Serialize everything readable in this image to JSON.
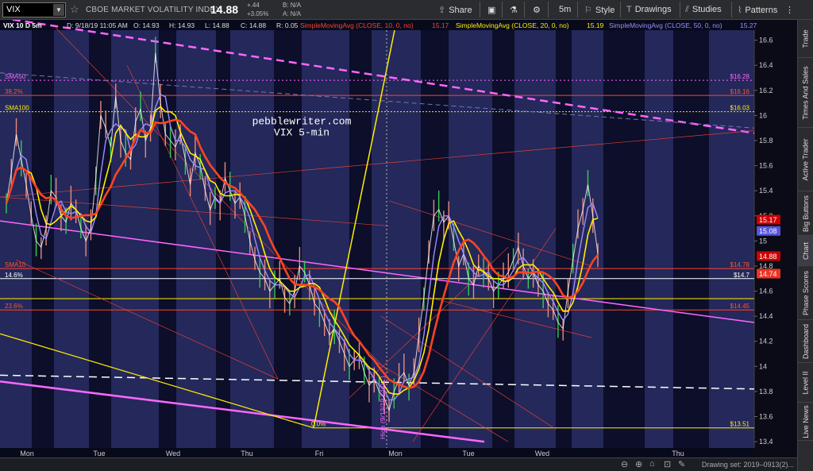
{
  "toolbar": {
    "symbol": "VIX",
    "symbol_name": "CBOE MARKET VOLATILITY INDEX",
    "last_price": "14.88",
    "change": "+.44",
    "change_pct": "+3.05%",
    "bid": "B: N/A",
    "ask": "A: N/A",
    "share": "Share",
    "timeframe": "5m",
    "style": "Style",
    "drawings": "Drawings",
    "studies": "Studies",
    "patterns": "Patterns"
  },
  "status": {
    "header": "VIX 10 D 5m",
    "datetime": "D: 9/18/19 11:05 AM",
    "open": "O: 14.93",
    "high": "H: 14.93",
    "low": "L: 14.88",
    "close": "C: 14.88",
    "range": "R: 0.05",
    "sma10_label": "SimpleMovingAvg (CLOSE, 10, 0, no)",
    "sma10_value": "15.17",
    "sma20_label": "SimpleMovingAvg (CLOSE, 20, 0, no)",
    "sma20_value": "15.19",
    "sma50_label": "SimpleMovingAvg (CLOSE, 50, 0, no)",
    "sma50_value": "15.27"
  },
  "side_tabs": [
    "Trade",
    "Times And Sales",
    "Active Trader",
    "Big Buttons",
    "Chart",
    "Phase Scores",
    "Dashboard",
    "Level II",
    "Live News"
  ],
  "bottom": {
    "drawing_set": "Drawing set: 2019–0913(2)..."
  },
  "colors": {
    "sma10": "#ffee00",
    "sma20": "#ff4422",
    "sma50": "#9f8cff",
    "price": "#e88b7a",
    "magenta": "#ff66ff",
    "fib": "#ff4433",
    "yellow_line": "#e8e020"
  },
  "chart_data": {
    "type": "line",
    "watermark": [
      "pebblewriter.com",
      "VIX 5-min"
    ],
    "y_ticks": [
      13.4,
      13.6,
      13.8,
      14,
      14.2,
      14.4,
      14.6,
      14.8,
      15,
      15.2,
      15.4,
      15.6,
      15.8,
      16,
      16.2,
      16.4,
      16.6
    ],
    "y_tick_labels": [
      "13.4",
      "13.6",
      "13.8",
      "14",
      "14.2",
      "14.4",
      "14.6",
      "14.8",
      "15",
      "15.2",
      "15.4",
      "15.6",
      "15.8",
      "16",
      "16.2",
      "16.4",
      "16.6"
    ],
    "x_labels": [
      "Mon",
      "Tue",
      "Wed",
      "Thu",
      "Fri",
      "Mon",
      "Tue",
      "Wed",
      "Thu"
    ],
    "ylim": [
      13.35,
      16.68
    ],
    "series": [
      {
        "name": "SMA10",
        "color": "#ffee00"
      },
      {
        "name": "SMA20",
        "color": "#ff4422"
      },
      {
        "name": "SMA50",
        "color": "#9f8cff"
      }
    ],
    "price_path": [
      15.3,
      15.55,
      15.85,
      15.65,
      15.45,
      15.2,
      15.0,
      14.95,
      15.1,
      15.4,
      15.35,
      15.2,
      15.15,
      15.3,
      15.25,
      15.1,
      15.0,
      15.1,
      15.5,
      16.0,
      15.9,
      15.75,
      16.15,
      15.8,
      15.7,
      15.65,
      15.95,
      16.05,
      15.8,
      15.9,
      16.5,
      16.1,
      15.85,
      15.8,
      15.75,
      15.85,
      15.65,
      15.45,
      15.7,
      15.6,
      15.4,
      15.25,
      15.35,
      15.3,
      15.5,
      15.4,
      15.3,
      15.35,
      15.2,
      15.0,
      14.85,
      14.75,
      14.7,
      14.6,
      14.65,
      14.7,
      14.55,
      14.5,
      14.6,
      14.8,
      14.75,
      14.65,
      14.5,
      14.45,
      14.35,
      14.25,
      14.3,
      14.2,
      14.1,
      14.0,
      14.05,
      14.1,
      13.95,
      13.85,
      13.9,
      13.8,
      13.75,
      13.65,
      13.8,
      13.9,
      13.95,
      13.85,
      13.95,
      14.25,
      14.55,
      14.9,
      15.2,
      15.25,
      15.15,
      15.2,
      15.0,
      14.8,
      14.9,
      14.7,
      14.65,
      14.8,
      14.75,
      14.7,
      14.6,
      14.65,
      14.7,
      14.75,
      14.85,
      14.95,
      14.8,
      14.7,
      14.75,
      14.65,
      14.6,
      14.5,
      14.45,
      14.35,
      14.3,
      14.6,
      14.85,
      15.1,
      15.25,
      15.45,
      15.2,
      14.9
    ],
    "h_levels": [
      {
        "label": "SMA50",
        "value": 16.28,
        "price_tag": "$16.28",
        "color": "#ff66ff"
      },
      {
        "label": "38.2%",
        "value": 16.16,
        "price_tag": "$16.16",
        "color": "#ff4433"
      },
      {
        "label": "SMA100",
        "value": 16.03,
        "price_tag": "$16.03",
        "color": "#ffee00"
      },
      {
        "label": "SMA10",
        "value": 14.78,
        "price_tag": "$14.78",
        "color": "#ff4433"
      },
      {
        "label": "14.6%",
        "value": 14.7,
        "price_tag": "$14.7",
        "color": "#ffffff"
      },
      {
        "label": "23.6%",
        "value": 14.45,
        "price_tag": "$14.45",
        "color": "#ff4433"
      },
      {
        "label": "0.0%",
        "value": 13.51,
        "price_tag": "$13.51",
        "color": "#ffee00"
      }
    ],
    "price_badges": [
      {
        "value": 15.17,
        "text": "15.17",
        "bg": "#cc0000"
      },
      {
        "value": 15.08,
        "text": "15.08",
        "bg": "#5555dd"
      },
      {
        "value": 14.88,
        "text": "14.88",
        "bg": "#cc0000"
      },
      {
        "value": 14.74,
        "text": "14.74",
        "bg": "#ee3322"
      }
    ],
    "annotations": [
      {
        "text": "High (9/13/19 14:0...)",
        "color": "#ff66ff"
      }
    ]
  }
}
